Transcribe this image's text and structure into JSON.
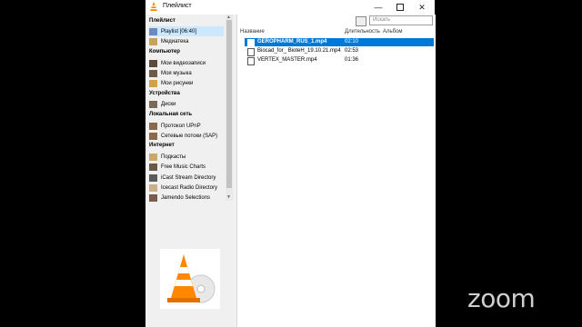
{
  "window": {
    "title": "Плейлист",
    "minimize_icon": "minimize-icon",
    "maximize_icon": "maximize-icon",
    "close_icon": "close-icon"
  },
  "sidebar": {
    "section_playlist": "Плейлист",
    "playlist_label": "Playlist [06:40]",
    "media_library": "Медиатека",
    "section_computer": "Компьютер",
    "my_videos": "Мои видеозаписи",
    "my_music": "Моя музыка",
    "my_pictures": "Мои рисунки",
    "section_devices": "Устройства",
    "disks": "Диски",
    "section_lan": "Локальная сеть",
    "upnp": "Протокол UPnP",
    "sap": "Сетевые потоки (SAP)",
    "section_internet": "Интернет",
    "podcasts": "Подкасты",
    "free_music_charts": "Free Music Charts",
    "icecast_stream": "iCast Stream Directory",
    "icecast_radio": "Icecast Radio Directory",
    "jamendo": "Jamendo Selections"
  },
  "main": {
    "search_placeholder": "Искать",
    "col_name": "Название",
    "col_duration": "Длительность",
    "col_album": "Альбом",
    "rows": [
      {
        "name": "GEROPHARM_RUS_1.mp4",
        "duration": "02:10"
      },
      {
        "name": "Biocad_for_ BioteH_19.10.21.mp4",
        "duration": "02:53"
      },
      {
        "name": "VERTEX_MASTER.mp4",
        "duration": "01:36"
      }
    ]
  },
  "overlay": {
    "zoom_logo": "zoom"
  },
  "colors": {
    "selection": "#0078d7",
    "sidebar_selected": "#cce8ff",
    "vlc_orange": "#ff8800"
  }
}
